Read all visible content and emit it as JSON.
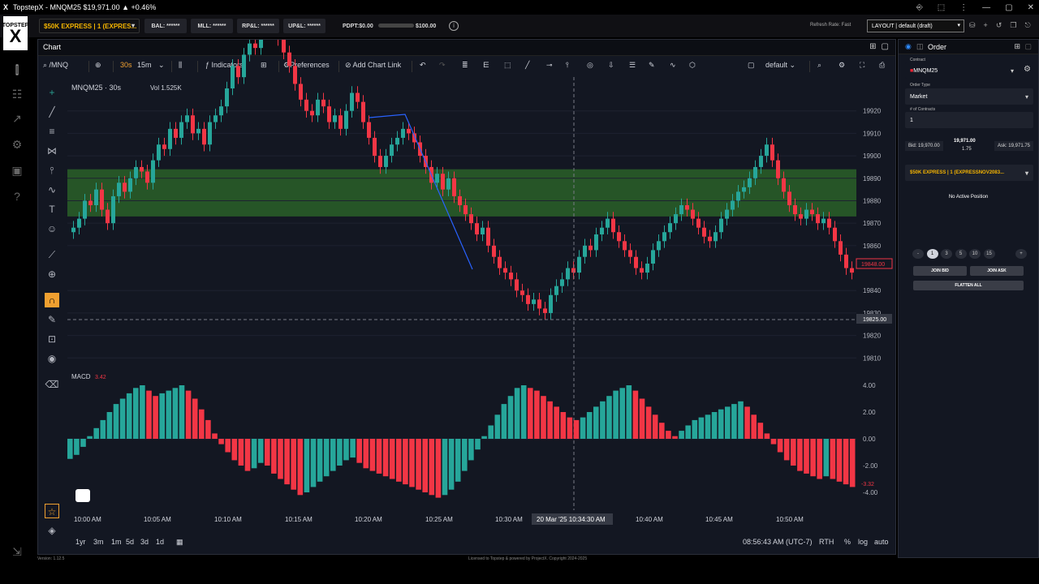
{
  "window": {
    "title": "TopstepX - MNQM25 $19,971.00 ▲ +0.46%",
    "controls": [
      "⎆",
      "⬚",
      "⋮",
      "—",
      "▢",
      "✕"
    ]
  },
  "topbar": {
    "brand_top": "TOPSTEP",
    "brand_mark": "X",
    "account": "$50K EXPRESS | 1 (EXPRES...",
    "stats": [
      {
        "label": "BAL: ******",
        "width": 52
      },
      {
        "label": "MLL: ******",
        "width": 52
      },
      {
        "label": "RP&L: ******",
        "width": 52
      },
      {
        "label": "UP&L: ******",
        "width": 52
      }
    ],
    "pdpt_label": "PDPT:$0.00",
    "pdpt_target": "$100.00",
    "pdpt_progress": 0,
    "refresh_rate": "Refresh Rate: Fast",
    "layout": "LAYOUT | default (draft)"
  },
  "chart_panel": {
    "tab": "Chart",
    "symbol": "/MNQ",
    "intervals": [
      "30s",
      "15m"
    ],
    "active_interval": "30s",
    "indicators_label": "Indicators",
    "preferences_label": "Preferences",
    "add_link_label": "Add Chart Link",
    "template_label": "default",
    "legend_symbol": "MNQM25 · 30s",
    "legend_vol": "Vol 1.525K",
    "macd_label": "MACD",
    "macd_value": "3.42",
    "crosshair_price": "19825.00",
    "crosshair_time": "20 Mar '25   10:34:30 AM",
    "last_price_label": "19848.00",
    "macd_last_label": "-3.32"
  },
  "chart_data": {
    "type": "candlestick",
    "symbol": "MNQM25",
    "interval": "30s",
    "y_ticks": [
      19920,
      19910,
      19900,
      19890,
      19880,
      19870,
      19860,
      19840,
      19830,
      19820,
      19810
    ],
    "x_ticks": [
      "10:00 AM",
      "10:05 AM",
      "10:10 AM",
      "10:15 AM",
      "10:20 AM",
      "10:25 AM",
      "10:30 AM",
      "10:40 AM",
      "10:45 AM",
      "10:50 AM"
    ],
    "zone": {
      "low": 19873,
      "high": 19894,
      "color": "#2e6b2a"
    },
    "closes": [
      19868,
      19872,
      19880,
      19878,
      19885,
      19876,
      19870,
      19882,
      19888,
      19884,
      19890,
      19895,
      19893,
      19888,
      19898,
      19905,
      19903,
      19912,
      19908,
      19915,
      19918,
      19910,
      19912,
      19905,
      19915,
      19918,
      19922,
      19930,
      19940,
      19935,
      19945,
      19950,
      19948,
      19955,
      19960,
      19958,
      19952,
      19946,
      19940,
      19932,
      19925,
      19920,
      19918,
      19925,
      19922,
      19915,
      19918,
      19912,
      19920,
      19928,
      19924,
      19915,
      19908,
      19900,
      19895,
      19900,
      19905,
      19908,
      19912,
      19910,
      19906,
      19900,
      19895,
      19888,
      19892,
      19885,
      19890,
      19882,
      19878,
      19874,
      19870,
      19865,
      19868,
      19860,
      19855,
      19850,
      19848,
      19845,
      19840,
      19838,
      19834,
      19836,
      19832,
      19830,
      19838,
      19842,
      19845,
      19850,
      19848,
      19855,
      19860,
      19858,
      19865,
      19868,
      19872,
      19866,
      19862,
      19858,
      19855,
      19850,
      19848,
      19852,
      19858,
      19862,
      19866,
      19870,
      19874,
      19878,
      19876,
      19872,
      19868,
      19864,
      19862,
      19866,
      19872,
      19876,
      19880,
      19884,
      19886,
      19890,
      19895,
      19900,
      19905,
      19898,
      19890,
      19884,
      19878,
      19874,
      19872,
      19876,
      19874,
      19870,
      19872,
      19868,
      19862,
      19856,
      19850,
      19848
    ],
    "macd": [
      -1.5,
      -1.2,
      -0.6,
      0.2,
      0.8,
      1.4,
      2.0,
      2.6,
      3.0,
      3.4,
      3.8,
      4.0,
      3.6,
      3.2,
      3.4,
      3.6,
      3.8,
      4.0,
      3.6,
      3.0,
      2.2,
      1.4,
      0.4,
      -0.4,
      -1.0,
      -1.6,
      -2.0,
      -2.4,
      -2.2,
      -1.8,
      -2.0,
      -2.6,
      -3.0,
      -3.4,
      -3.8,
      -4.2,
      -4.0,
      -3.6,
      -3.2,
      -2.8,
      -2.4,
      -2.0,
      -1.6,
      -1.4,
      -1.8,
      -2.2,
      -2.4,
      -2.6,
      -2.8,
      -3.0,
      -3.2,
      -3.4,
      -3.6,
      -3.8,
      -4.0,
      -4.2,
      -4.4,
      -4.2,
      -3.8,
      -3.2,
      -2.4,
      -1.6,
      -0.8,
      0.2,
      1.0,
      1.8,
      2.6,
      3.2,
      3.8,
      4.0,
      3.8,
      3.6,
      3.2,
      2.8,
      2.4,
      2.0,
      1.6,
      1.4,
      1.6,
      2.0,
      2.4,
      2.8,
      3.2,
      3.6,
      3.8,
      4.0,
      3.6,
      3.0,
      2.4,
      1.8,
      1.2,
      0.6,
      0.2,
      0.6,
      1.0,
      1.4,
      1.6,
      1.8,
      2.0,
      2.2,
      2.4,
      2.6,
      2.8,
      2.4,
      1.8,
      1.2,
      0.4,
      -0.4,
      -1.0,
      -1.6,
      -2.0,
      -2.4,
      -2.6,
      -2.8,
      -3.0,
      -2.8,
      -3.0,
      -3.2,
      -3.4,
      -3.6
    ]
  },
  "bottom": {
    "ranges": [
      "1yr",
      "3m",
      "1m",
      "5d",
      "3d",
      "1d"
    ],
    "clock": "08:56:43 AM (UTC-7)",
    "session": "RTH",
    "pct": "%",
    "log": "log",
    "auto": "auto"
  },
  "order_panel": {
    "title": "Order",
    "contract_label": "Contract",
    "contract": "MNQM25",
    "order_type_label": "Order Type",
    "order_type": "Market",
    "contracts_label": "# of Contracts",
    "contracts": "1",
    "bid": "Bid: 19,970.00",
    "last": "19,971.00",
    "spread": "1.75",
    "ask": "Ask: 19,971.75",
    "account": "$50K EXPRESS | 1 (EXPRESSNOV2083...",
    "position": "No Active Position",
    "quantities": [
      "-",
      "1",
      "3",
      "5",
      "10",
      "15",
      "+"
    ],
    "join_bid": "JOIN BID",
    "join_ask": "JOIN ASK",
    "flatten": "FLATTEN ALL"
  },
  "footer": {
    "version": "Version: 1.12.5",
    "license": "Licensed to Topstep & powered by ProjectX. Copyright 2024-2025"
  }
}
